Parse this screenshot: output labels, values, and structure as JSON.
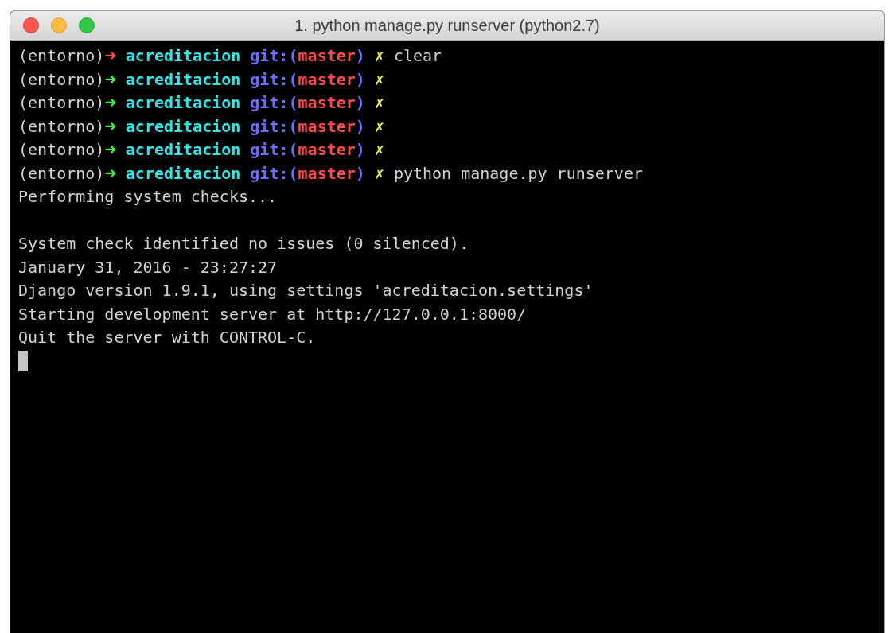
{
  "window": {
    "title": "1. python manage.py runserver (python2.7)"
  },
  "terminal": {
    "lines": [
      {
        "kind": "prompt",
        "env": "(entorno)",
        "arrow": "➜",
        "success": false,
        "dir": "acreditacion",
        "git_open": "git:(",
        "branch": "master",
        "git_close": ")",
        "dirty_mark": "✗",
        "command": "clear"
      },
      {
        "kind": "prompt",
        "env": "(entorno)",
        "arrow": "➜",
        "success": true,
        "dir": "acreditacion",
        "git_open": "git:(",
        "branch": "master",
        "git_close": ")",
        "dirty_mark": "✗"
      },
      {
        "kind": "prompt",
        "env": "(entorno)",
        "arrow": "➜",
        "success": true,
        "dir": "acreditacion",
        "git_open": "git:(",
        "branch": "master",
        "git_close": ")",
        "dirty_mark": "✗"
      },
      {
        "kind": "prompt",
        "env": "(entorno)",
        "arrow": "➜",
        "success": true,
        "dir": "acreditacion",
        "git_open": "git:(",
        "branch": "master",
        "git_close": ")",
        "dirty_mark": "✗"
      },
      {
        "kind": "prompt",
        "env": "(entorno)",
        "arrow": "➜",
        "success": true,
        "dir": "acreditacion",
        "git_open": "git:(",
        "branch": "master",
        "git_close": ")",
        "dirty_mark": "✗"
      },
      {
        "kind": "prompt",
        "env": "(entorno)",
        "arrow": "➜",
        "success": true,
        "dir": "acreditacion",
        "git_open": "git:(",
        "branch": "master",
        "git_close": ")",
        "dirty_mark": "✗",
        "command": "python manage.py runserver"
      },
      {
        "kind": "output",
        "text": "Performing system checks..."
      },
      {
        "kind": "blank"
      },
      {
        "kind": "output",
        "text": "System check identified no issues (0 silenced)."
      },
      {
        "kind": "output",
        "text": "January 31, 2016 - 23:27:27"
      },
      {
        "kind": "output",
        "text": "Django version 1.9.1, using settings 'acreditacion.settings'"
      },
      {
        "kind": "output",
        "text": "Starting development server at http://127.0.0.1:8000/"
      },
      {
        "kind": "output",
        "text": "Quit the server with CONTROL-C."
      },
      {
        "kind": "cursor"
      }
    ]
  }
}
